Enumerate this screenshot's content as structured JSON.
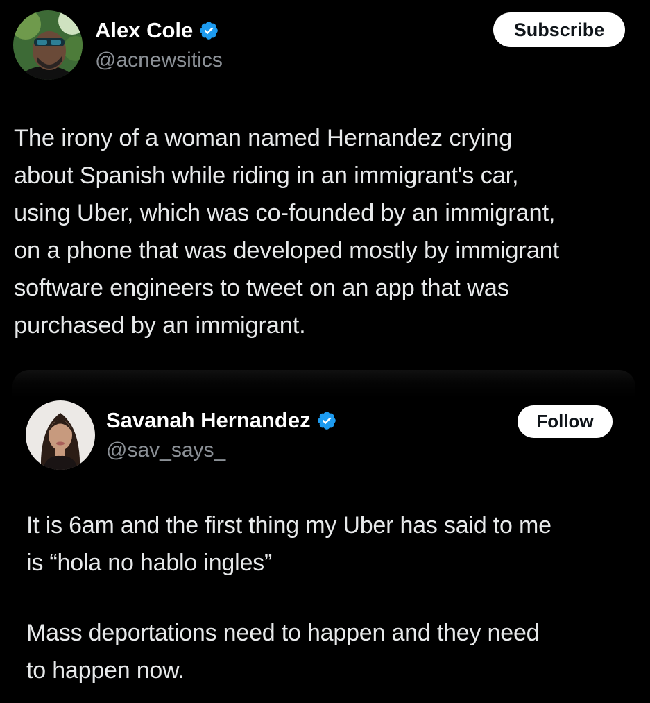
{
  "colors": {
    "background": "#000000",
    "text": "#e7e9ea",
    "muted": "#8b9096",
    "verified": "#1d9bf0",
    "button_bg": "#ffffff",
    "button_text": "#0f1419"
  },
  "main_post": {
    "author": {
      "display_name": "Alex Cole",
      "handle": "@acnewsitics",
      "verified_icon": "verified-badge-icon"
    },
    "subscribe_label": "Subscribe",
    "text": "The irony of a woman named Hernandez crying\nabout Spanish while riding in an immigrant's car,\nusing Uber, which was co-founded by an immigrant,\non a phone that was developed mostly by immigrant\nsoftware engineers to tweet on an app that was\npurchased by an immigrant."
  },
  "quoted_post": {
    "author": {
      "display_name": "Savanah Hernandez",
      "handle": "@sav_says_",
      "verified_icon": "verified-badge-icon"
    },
    "follow_label": "Follow",
    "paragraphs": [
      "It is 6am and the first thing my Uber has said to me\nis “hola no hablo ingles”",
      "Mass deportations need to happen and they need\nto happen now."
    ]
  }
}
